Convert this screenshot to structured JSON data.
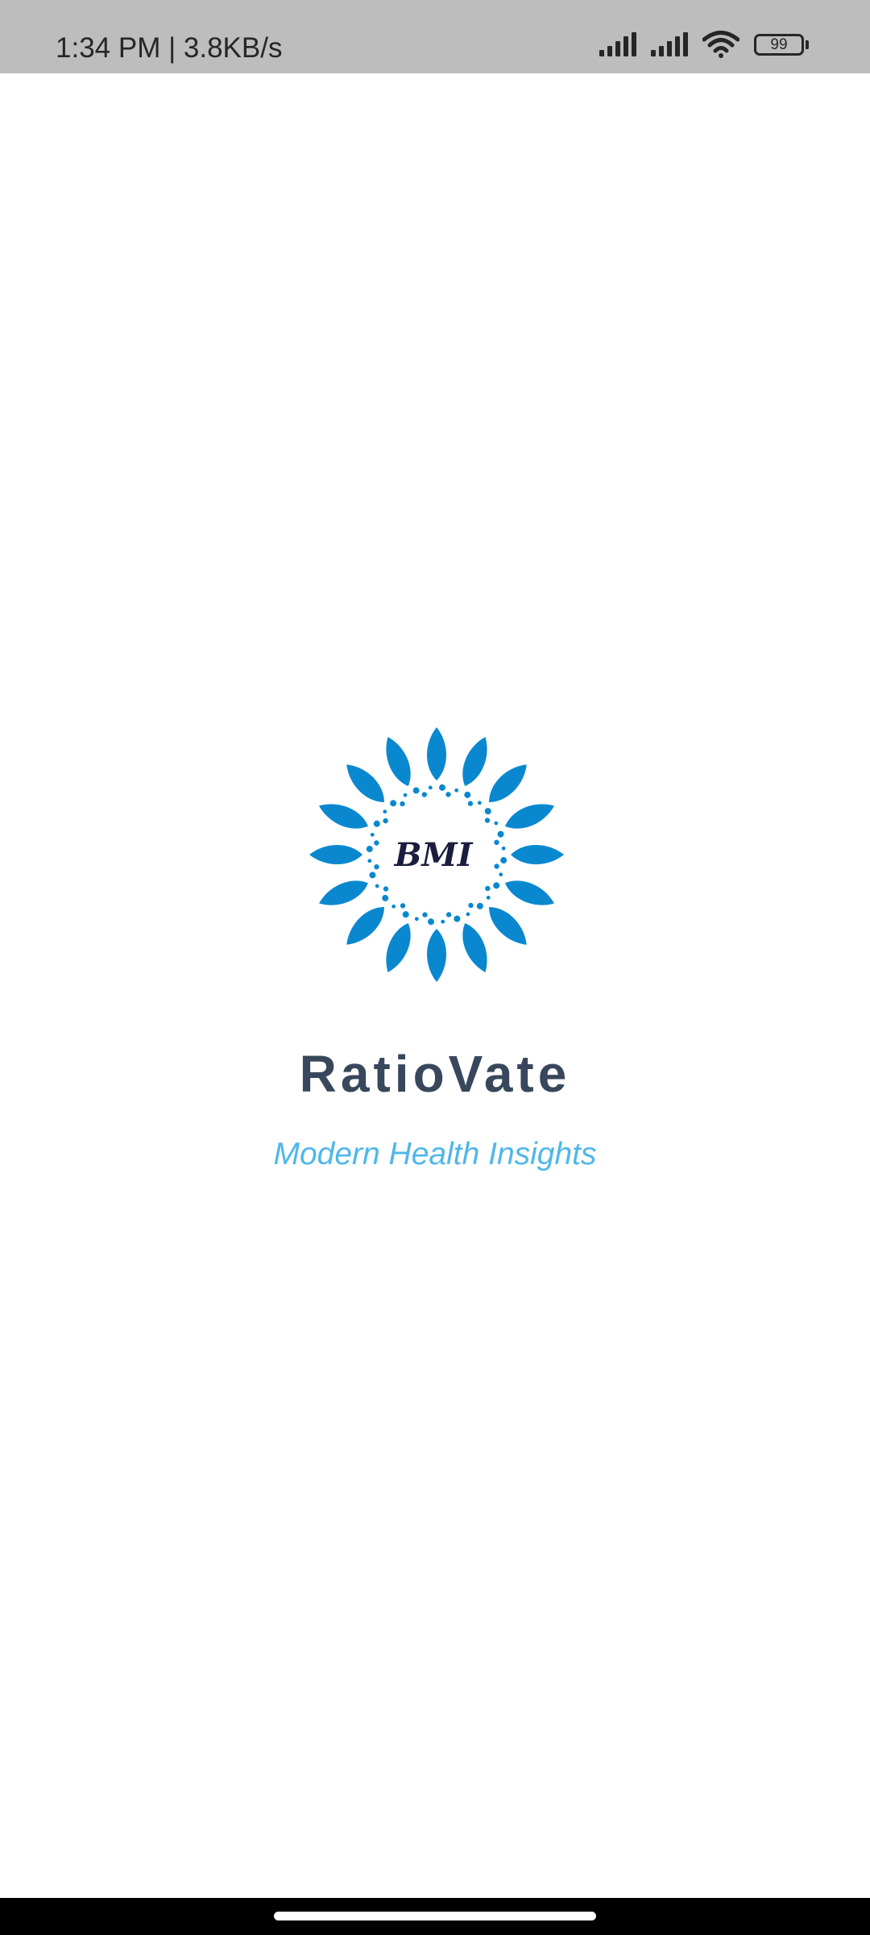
{
  "status_bar": {
    "time_speed": "1:34 PM | 3.8KB/s",
    "battery_level": "99",
    "icons": [
      "signal-icon",
      "signal-icon",
      "wifi-icon",
      "battery-icon"
    ]
  },
  "splash": {
    "logo_text": "BMI",
    "title": "RatioVate",
    "tagline": "Modern Health Insights"
  },
  "colors": {
    "logo_blue": "#0a88cf",
    "logo_text": "#1b1d3e",
    "title": "#38475c",
    "tagline": "#4fb7ea",
    "status_bar_bg": "#bdbdbd"
  }
}
